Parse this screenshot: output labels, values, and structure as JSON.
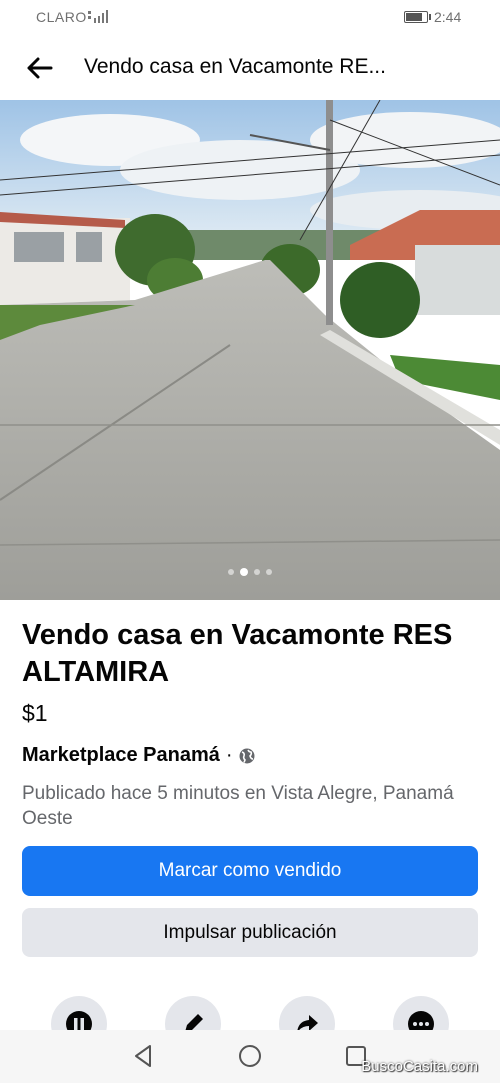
{
  "status_bar": {
    "carrier": "CLARO",
    "time": "2:44",
    "battery_level": 0.8
  },
  "header": {
    "title": "Vendo casa en Vacamonte RE..."
  },
  "photo": {
    "slide_count": 4,
    "active_slide": 2
  },
  "listing": {
    "title": "Vendo casa en Vacamonte RES ALTAMIRA",
    "price": "$1",
    "seller": "Marketplace Panamá",
    "separator": "·",
    "posted": "Publicado hace 5 minutos en Vista Alegre, Panamá Oeste"
  },
  "buttons": {
    "mark_sold": "Marcar como vendido",
    "boost": "Impulsar publicación"
  },
  "actions": [
    "pause-icon",
    "edit-icon",
    "share-icon",
    "more-icon"
  ],
  "watermark": "BuscoCasita.com",
  "colors": {
    "primary": "#1877f2",
    "secondary": "#e4e6eb",
    "muted_text": "#65676b"
  }
}
